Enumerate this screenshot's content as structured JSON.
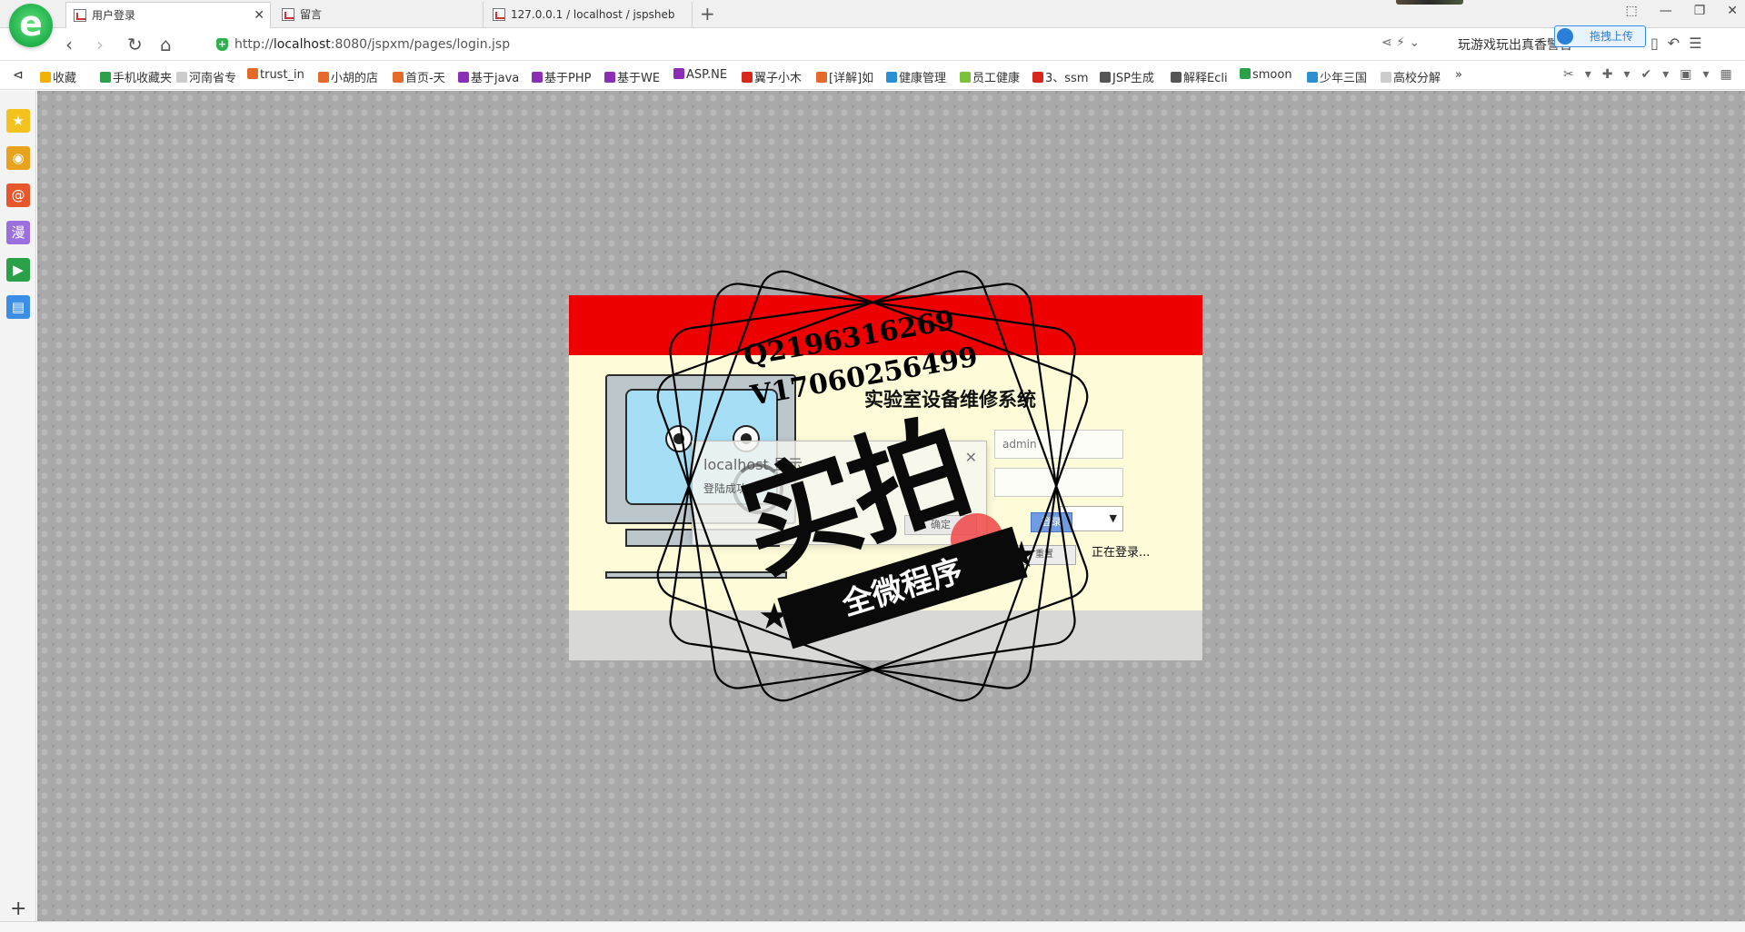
{
  "browser": {
    "logo": "e",
    "tabs": [
      {
        "title": "用户登录",
        "active": true
      },
      {
        "title": "留言",
        "active": false
      },
      {
        "title": "127.0.0.1 / localhost / jspsheb",
        "active": false
      }
    ],
    "new_tab": "+",
    "window_controls": [
      "⬚",
      "—",
      "❐",
      "✕"
    ],
    "address": {
      "prefix": "http://",
      "host": "localhost",
      "rest": ":8080/jspxm/pages/login.jsp"
    },
    "promo_text": "玩游戏玩出真香警告",
    "upload_button": "拖拽上传",
    "bookmarks": [
      {
        "label": "收藏",
        "color": "#f2b300"
      },
      {
        "label": "手机收藏夹",
        "color": "#2aa148"
      },
      {
        "label": "河南省专",
        "color": "#cccccc"
      },
      {
        "label": "trust_in",
        "color": "#e46a2a"
      },
      {
        "label": "小胡的店",
        "color": "#e46a2a"
      },
      {
        "label": "首页-天",
        "color": "#e46a2a"
      },
      {
        "label": "基于java",
        "color": "#8a2fb5"
      },
      {
        "label": "基于PHP",
        "color": "#8a2fb5"
      },
      {
        "label": "基于WE",
        "color": "#8a2fb5"
      },
      {
        "label": "ASP.NE",
        "color": "#8a2fb5"
      },
      {
        "label": "翼子小木",
        "color": "#d9261c"
      },
      {
        "label": "[详解]如",
        "color": "#e46a2a"
      },
      {
        "label": "健康管理",
        "color": "#2a8fd0"
      },
      {
        "label": "员工健康",
        "color": "#7cc13a"
      },
      {
        "label": "3、ssm",
        "color": "#d9261c"
      },
      {
        "label": "JSP生成",
        "color": "#555555"
      },
      {
        "label": "解释Ecli",
        "color": "#555555"
      },
      {
        "label": "smoon",
        "color": "#2aa148"
      },
      {
        "label": "少年三国",
        "color": "#2a8fd0"
      },
      {
        "label": "高校分解",
        "color": "#cccccc"
      }
    ],
    "bookmarks_more": "»"
  },
  "sidebar": {
    "items": [
      {
        "icon": "star-icon",
        "glyph": "★",
        "color": "#f4c21c"
      },
      {
        "icon": "weibo-icon",
        "glyph": "◉",
        "color": "#e8a21c"
      },
      {
        "icon": "mail-icon",
        "glyph": "@",
        "color": "#e8562c"
      },
      {
        "icon": "comic-icon",
        "glyph": "漫",
        "color": "#9a6fe0"
      },
      {
        "icon": "video-icon",
        "glyph": "▶",
        "color": "#2aa148"
      },
      {
        "icon": "document-icon",
        "glyph": "▤",
        "color": "#3a8ee6"
      }
    ],
    "add": "+"
  },
  "page": {
    "system_title": "实验室设备维修系统",
    "username_placeholder": "admin",
    "password_placeholder": "",
    "role_select": "▼",
    "login_button": "登录",
    "reset_button": "重置",
    "status_text": "正在登录...",
    "alert": {
      "title": "localhost 显示",
      "message": "登陆成功",
      "close": "✕",
      "ok": "确定"
    }
  },
  "watermark": {
    "qq": "Q2196316269",
    "vx": "V17060256499",
    "main": "实拍",
    "ribbon": "全微程序"
  }
}
